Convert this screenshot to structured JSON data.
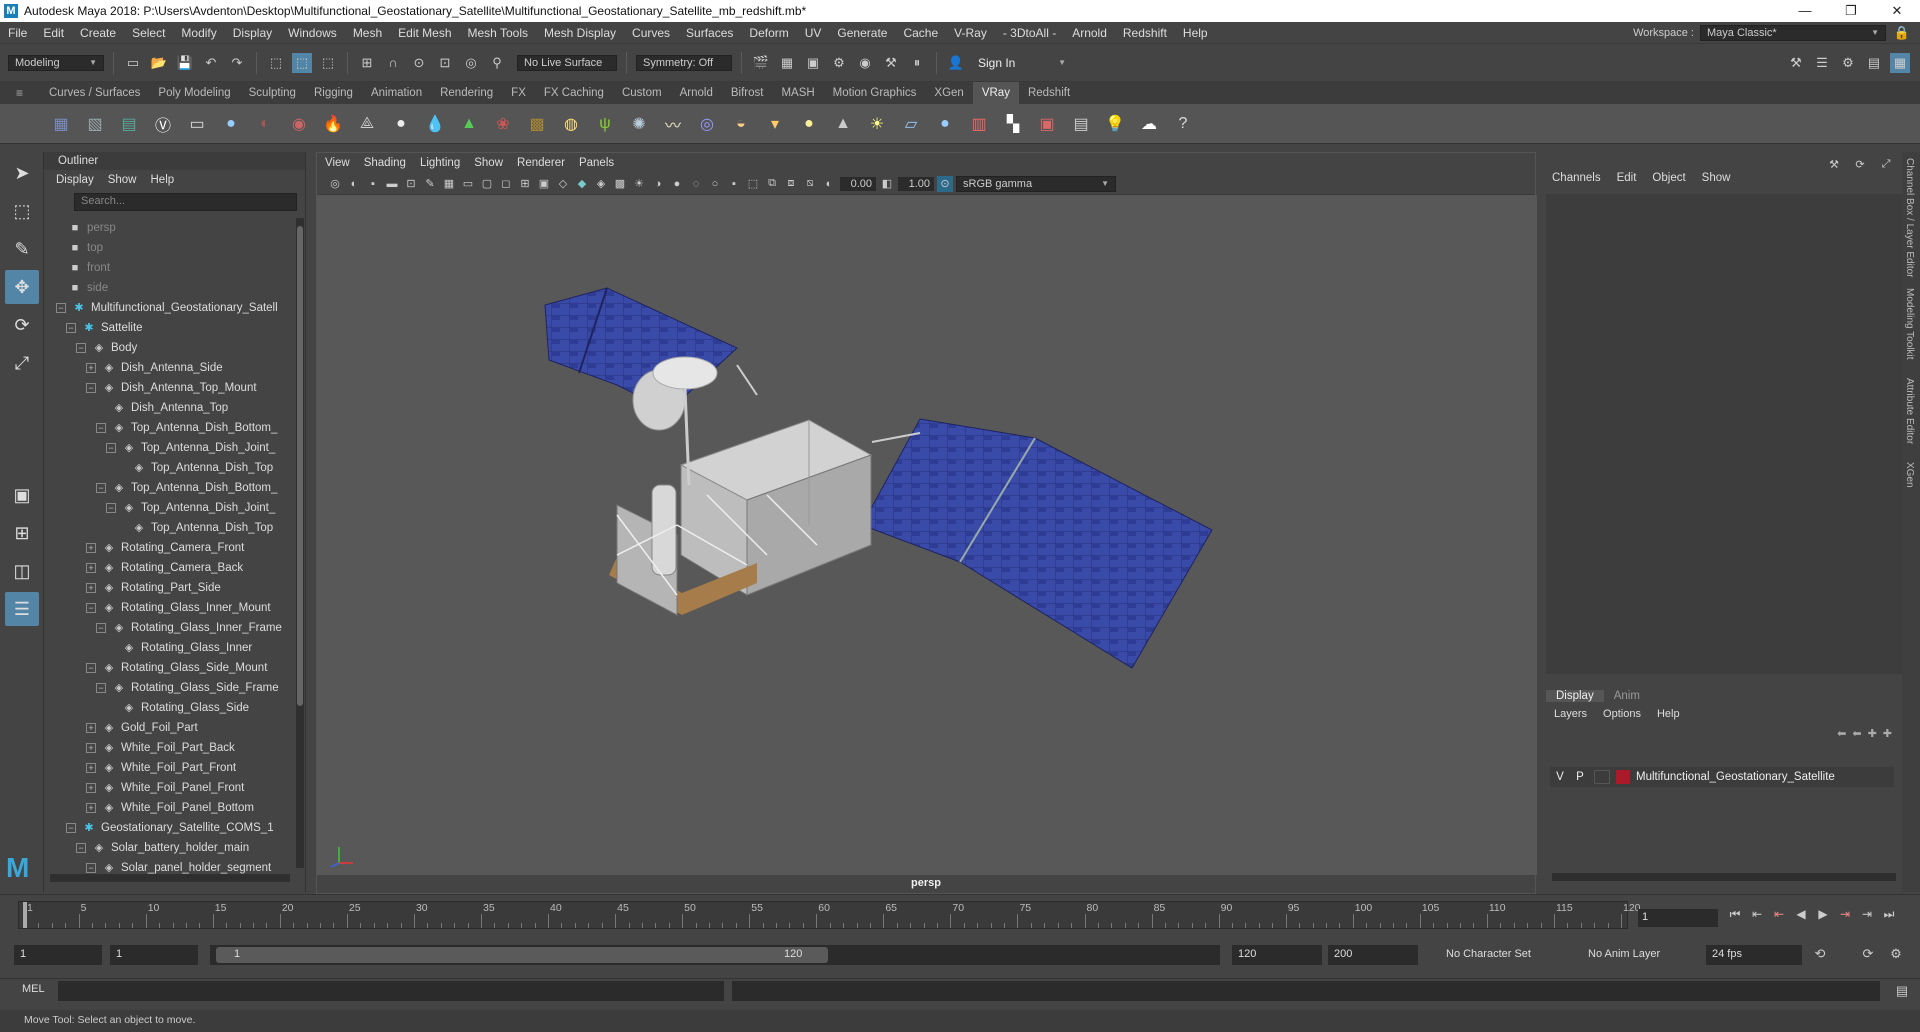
{
  "titlebar": {
    "title": "Autodesk Maya 2018: P:\\Users\\Avdenton\\Desktop\\Multifunctional_Geostationary_Satellite\\Multifunctional_Geostationary_Satellite_mb_redshift.mb*",
    "minimize": "—",
    "maximize": "❐",
    "close": "✕"
  },
  "menubar": {
    "items": [
      "File",
      "Edit",
      "Create",
      "Select",
      "Modify",
      "Display",
      "Windows",
      "Mesh",
      "Edit Mesh",
      "Mesh Tools",
      "Mesh Display",
      "Curves",
      "Surfaces",
      "Deform",
      "UV",
      "Generate",
      "Cache",
      "V-Ray",
      "- 3DtoAll -",
      "Arnold",
      "Redshift",
      "Help"
    ],
    "workspace_label": "Workspace :",
    "workspace_value": "Maya Classic*"
  },
  "statusline": {
    "mode": "Modeling",
    "live_surface": "No Live Surface",
    "symmetry": "Symmetry: Off",
    "sign_in": "Sign In"
  },
  "shelf": {
    "tabs": [
      "Curves / Surfaces",
      "Poly Modeling",
      "Sculpting",
      "Rigging",
      "Animation",
      "Rendering",
      "FX",
      "FX Caching",
      "Custom",
      "Arnold",
      "Bifrost",
      "MASH",
      "Motion Graphics",
      "XGen",
      "VRay",
      "Redshift"
    ],
    "active_tab": "VRay",
    "icons": [
      "vray-objects-icon",
      "vray-proxy-icon",
      "vray-scene-icon",
      "vray-logo-icon",
      "vray-frame-buffer-icon",
      "vray-sphere-icon",
      "vray-material-icon",
      "vray-shader-icon",
      "vray-fire-icon",
      "vray-mesh-light-icon",
      "vray-sphere-light-icon",
      "vray-water-icon",
      "vray-prism-icon",
      "vray-fur-icon",
      "vray-texture-icon",
      "vray-dome-icon",
      "vray-grass-icon",
      "vray-gear-icon",
      "vray-curve-icon",
      "vray-globe-icon",
      "vray-half-sphere-icon",
      "vray-spot-icon",
      "vray-disc-icon",
      "vray-cone-icon",
      "vray-sun-icon",
      "vray-plane-icon",
      "vray-ball-icon",
      "vray-stripes-icon",
      "vray-checker-icon",
      "vray-render-icon",
      "vray-table-icon",
      "vray-light-icon",
      "vray-cloud-icon",
      "help-icon"
    ]
  },
  "outliner": {
    "title": "Outliner",
    "menu": [
      "Display",
      "Show",
      "Help"
    ],
    "search_placeholder": "Search...",
    "rows": [
      {
        "label": "persp",
        "indent": 0,
        "type": "cam",
        "exp": ""
      },
      {
        "label": "top",
        "indent": 0,
        "type": "cam",
        "exp": ""
      },
      {
        "label": "front",
        "indent": 0,
        "type": "cam",
        "exp": ""
      },
      {
        "label": "side",
        "indent": 0,
        "type": "cam",
        "exp": ""
      },
      {
        "label": "Multifunctional_Geostationary_Satell",
        "indent": 0,
        "type": "star",
        "exp": "−"
      },
      {
        "label": "Sattelite",
        "indent": 1,
        "type": "star",
        "exp": "−"
      },
      {
        "label": "Body",
        "indent": 2,
        "type": "mesh",
        "exp": "−"
      },
      {
        "label": "Dish_Antenna_Side",
        "indent": 3,
        "type": "mesh",
        "exp": "+"
      },
      {
        "label": "Dish_Antenna_Top_Mount",
        "indent": 3,
        "type": "mesh",
        "exp": "−"
      },
      {
        "label": "Dish_Antenna_Top",
        "indent": 4,
        "type": "mesh",
        "exp": ""
      },
      {
        "label": "Top_Antenna_Dish_Bottom_",
        "indent": 4,
        "type": "mesh",
        "exp": "−"
      },
      {
        "label": "Top_Antenna_Dish_Joint_",
        "indent": 5,
        "type": "mesh",
        "exp": "−"
      },
      {
        "label": "Top_Antenna_Dish_Top",
        "indent": 6,
        "type": "mesh",
        "exp": ""
      },
      {
        "label": "Top_Antenna_Dish_Bottom_",
        "indent": 4,
        "type": "mesh",
        "exp": "−"
      },
      {
        "label": "Top_Antenna_Dish_Joint_",
        "indent": 5,
        "type": "mesh",
        "exp": "−"
      },
      {
        "label": "Top_Antenna_Dish_Top",
        "indent": 6,
        "type": "mesh",
        "exp": ""
      },
      {
        "label": "Rotating_Camera_Front",
        "indent": 3,
        "type": "mesh",
        "exp": "+"
      },
      {
        "label": "Rotating_Camera_Back",
        "indent": 3,
        "type": "mesh",
        "exp": "+"
      },
      {
        "label": "Rotating_Part_Side",
        "indent": 3,
        "type": "mesh",
        "exp": "+"
      },
      {
        "label": "Rotating_Glass_Inner_Mount",
        "indent": 3,
        "type": "mesh",
        "exp": "−"
      },
      {
        "label": "Rotating_Glass_Inner_Frame",
        "indent": 4,
        "type": "mesh",
        "exp": "−"
      },
      {
        "label": "Rotating_Glass_Inner",
        "indent": 5,
        "type": "mesh",
        "exp": ""
      },
      {
        "label": "Rotating_Glass_Side_Mount",
        "indent": 3,
        "type": "mesh",
        "exp": "−"
      },
      {
        "label": "Rotating_Glass_Side_Frame",
        "indent": 4,
        "type": "mesh",
        "exp": "−"
      },
      {
        "label": "Rotating_Glass_Side",
        "indent": 5,
        "type": "mesh",
        "exp": ""
      },
      {
        "label": "Gold_Foil_Part",
        "indent": 3,
        "type": "mesh",
        "exp": "+"
      },
      {
        "label": "White_Foil_Part_Back",
        "indent": 3,
        "type": "mesh",
        "exp": "+"
      },
      {
        "label": "White_Foil_Part_Front",
        "indent": 3,
        "type": "mesh",
        "exp": "+"
      },
      {
        "label": "White_Foil_Panel_Front",
        "indent": 3,
        "type": "mesh",
        "exp": "+"
      },
      {
        "label": "White_Foil_Panel_Bottom",
        "indent": 3,
        "type": "mesh",
        "exp": "+"
      },
      {
        "label": "Geostationary_Satellite_COMS_1",
        "indent": 1,
        "type": "star",
        "exp": "−"
      },
      {
        "label": "Solar_battery_holder_main",
        "indent": 2,
        "type": "mesh",
        "exp": "−"
      },
      {
        "label": "Solar_panel_holder_segment",
        "indent": 3,
        "type": "mesh",
        "exp": "−"
      }
    ]
  },
  "viewport": {
    "menu": [
      "View",
      "Shading",
      "Lighting",
      "Show",
      "Renderer",
      "Panels"
    ],
    "exposure": "0.00",
    "gamma": "1.00",
    "color_space": "sRGB gamma",
    "camera_label": "persp"
  },
  "channelbox": {
    "menu": [
      "Channels",
      "Edit",
      "Object",
      "Show"
    ],
    "side_tabs": [
      "Channel Box / Layer Editor",
      "Modeling Toolkit",
      "Attribute Editor",
      "XGen"
    ],
    "layer_tabs": [
      "Display",
      "Anim"
    ],
    "layer_menu": [
      "Layers",
      "Options",
      "Help"
    ],
    "layer": {
      "v": "V",
      "p": "P",
      "name": "Multifunctional_Geostationary_Satellite",
      "color": "#aa1a2a"
    }
  },
  "timeline": {
    "ticks": [
      "1",
      "5",
      "10",
      "15",
      "20",
      "25",
      "30",
      "35",
      "40",
      "45",
      "50",
      "55",
      "60",
      "65",
      "70",
      "75",
      "80",
      "85",
      "90",
      "95",
      "100",
      "105",
      "110",
      "115",
      "120"
    ],
    "current_frame": "1",
    "range_start": "1",
    "range_start2": "1",
    "range_slider_start": "1",
    "range_slider_end": "120",
    "end_frame": "120",
    "max_frame": "200",
    "character_set": "No Character Set",
    "anim_layer": "No Anim Layer",
    "fps": "24 fps"
  },
  "commandline": {
    "label": "MEL"
  },
  "helpline": {
    "text": "Move Tool: Select an object to move."
  }
}
